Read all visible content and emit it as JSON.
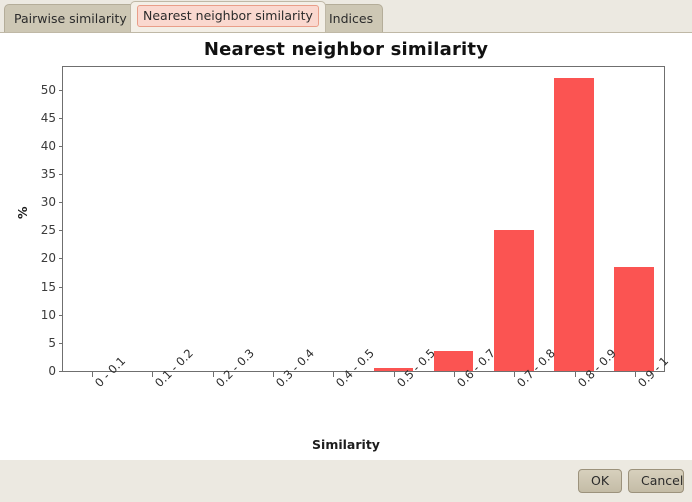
{
  "window": {
    "background_color": "#ece9e1"
  },
  "tabs": [
    {
      "label": "Pairwise similarity",
      "selected": false
    },
    {
      "label": "Nearest neighbor similarity",
      "selected": true
    },
    {
      "label": "Indices",
      "selected": false
    }
  ],
  "footer": {
    "ok_label": "OK",
    "cancel_label": "Cancel"
  },
  "chart_data": {
    "type": "bar",
    "title": "Nearest neighbor similarity",
    "xlabel": "Similarity",
    "ylabel": "%",
    "categories": [
      "0 - 0.1",
      "0.1 - 0.2",
      "0.2 - 0.3",
      "0.3 - 0.4",
      "0.4 - 0.5",
      "0.5 - 0.5",
      "0.6 - 0.7",
      "0.7 - 0.8",
      "0.8 - 0.9",
      "0.9 - 1"
    ],
    "values": [
      0,
      0,
      0,
      0,
      0,
      0.5,
      3.5,
      25,
      52,
      18.5
    ],
    "ylim": [
      0,
      54
    ],
    "yticks": [
      0,
      5,
      10,
      15,
      20,
      25,
      30,
      35,
      40,
      45,
      50
    ],
    "bar_color": "#fb5452",
    "grid": false,
    "legend": "none"
  }
}
